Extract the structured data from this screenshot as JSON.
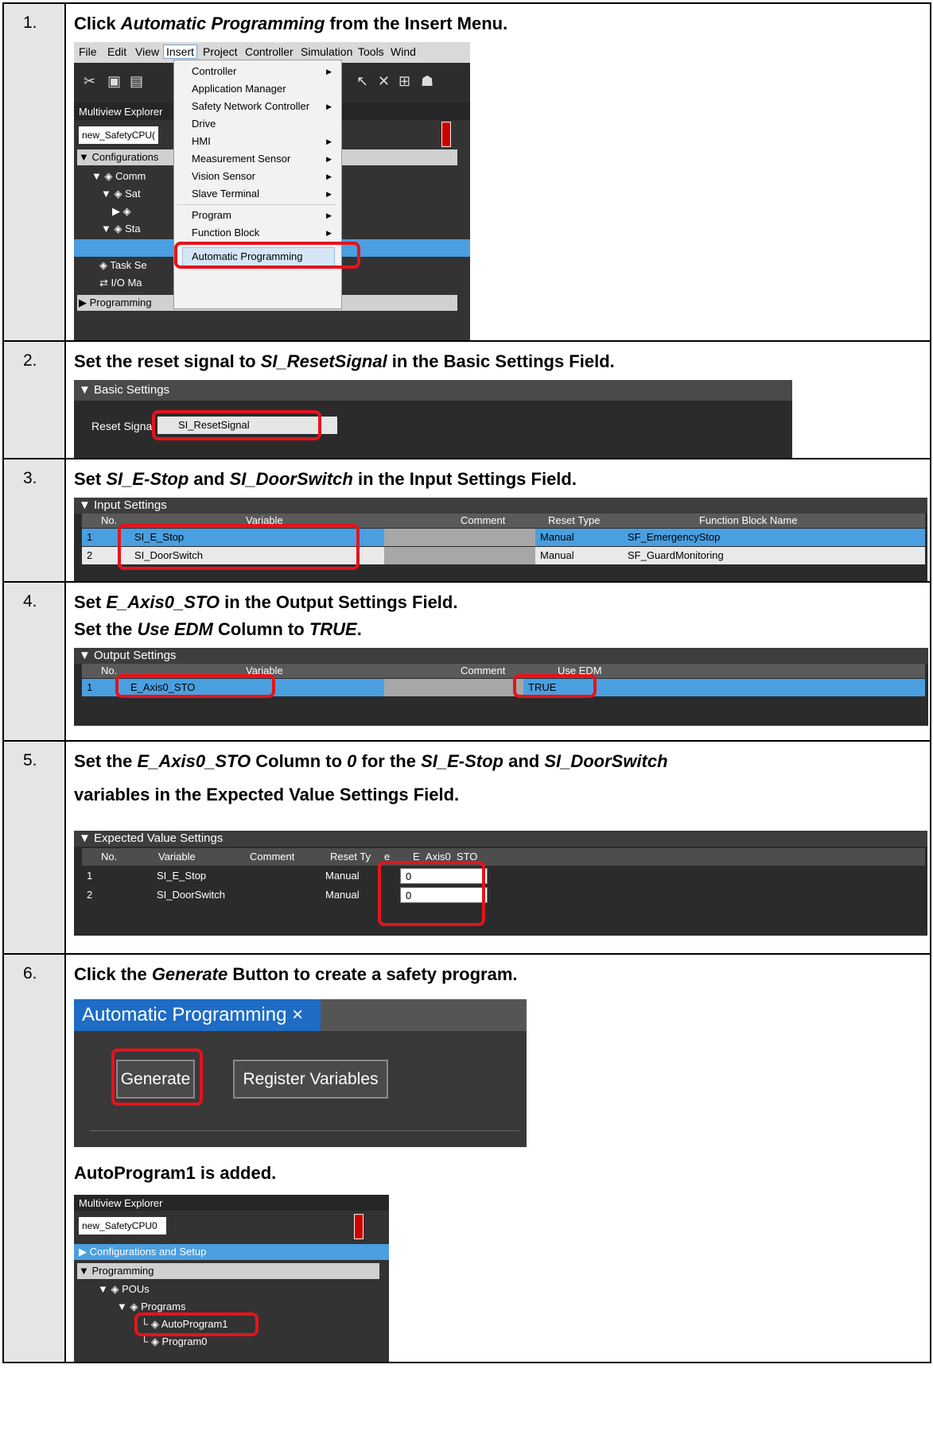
{
  "steps": [
    {
      "num": "1.",
      "parts": [
        "Click ",
        "Automatic Programming",
        " from the Insert Menu."
      ],
      "menubar": [
        "File",
        "Edit",
        "View",
        "Insert",
        "Project",
        "Controller",
        "Simulation",
        "Tools",
        "Wind"
      ],
      "menu_items": [
        "Controller",
        "Application Manager",
        "Safety Network Controller",
        "Drive",
        "HMI",
        "Measurement Sensor",
        "Vision Sensor",
        "Slave Terminal",
        "Program",
        "Function Block",
        "Automatic Programming"
      ],
      "explorer_title": "Multiview Explorer",
      "controller_select": "new_SafetyCPU(",
      "tree": [
        "Configurations",
        "Comm",
        "Sat",
        "",
        "Sta",
        "",
        "Task Se",
        "I/O Ma",
        "Programming"
      ]
    },
    {
      "num": "2.",
      "parts": [
        "Set the reset signal to ",
        "SI_ResetSignal",
        " in the Basic Settings Field."
      ],
      "panel_title": "Basic Settings",
      "field_label": "Reset Signal",
      "field_value": "SI_ResetSignal"
    },
    {
      "num": "3.",
      "parts": [
        "Set ",
        "SI_E-Stop",
        " and ",
        "SI_DoorSwitch",
        " in the Input Settings Field."
      ],
      "panel_title": "Input Settings",
      "headers": [
        "No.",
        "Variable",
        "Comment",
        "Reset Type",
        "Function Block Name"
      ],
      "rows": [
        [
          "1",
          "SI_E_Stop",
          "",
          "Manual",
          "SF_EmergencyStop"
        ],
        [
          "2",
          "SI_DoorSwitch",
          "",
          "Manual",
          "SF_GuardMonitoring"
        ]
      ]
    },
    {
      "num": "4.",
      "line1": [
        "Set ",
        "E_Axis0_STO",
        " in the Output Settings Field."
      ],
      "line2": [
        "Set the ",
        "Use EDM",
        " Column to ",
        "TRUE",
        "."
      ],
      "panel_title": "Output Settings",
      "headers": [
        "No.",
        "Variable",
        "Comment",
        "Use EDM"
      ],
      "rows": [
        [
          "1",
          "E_Axis0_STO",
          "",
          "TRUE"
        ]
      ]
    },
    {
      "num": "5.",
      "line1": [
        "Set the ",
        "E_Axis0_STO",
        " Column to ",
        "0",
        " for the ",
        "SI_E-Stop",
        " and ",
        "SI_DoorSwitch"
      ],
      "line2": "variables in the Expected Value Settings Field.",
      "panel_title": "Expected Value Settings",
      "headers": [
        "No.",
        "Variable",
        "Comment",
        "Reset Ty",
        "e",
        "E_Axis0_STO"
      ],
      "rows": [
        [
          "1",
          "SI_E_Stop",
          "",
          "Manual",
          "0"
        ],
        [
          "2",
          "SI_DoorSwitch",
          "",
          "Manual",
          "0"
        ]
      ]
    },
    {
      "num": "6.",
      "parts": [
        "Click the ",
        "Generate",
        " Button to create a safety program."
      ],
      "tab_title": "Automatic Programming",
      "tab_close": "×",
      "btn_generate": "Generate",
      "btn_register": "Register Variables",
      "result_text": "AutoProgram1 is added.",
      "explorer_title": "Multiview Explorer",
      "controller_select": "new_SafetyCPU0",
      "tree": [
        "Configurations and Setup",
        "Programming",
        "POUs",
        "Programs",
        "AutoProgram1",
        "Program0"
      ]
    }
  ],
  "colors": {
    "highlight": "#e5131d",
    "selection": "#4a9fe0",
    "dark_bg": "#2b2b2b"
  }
}
